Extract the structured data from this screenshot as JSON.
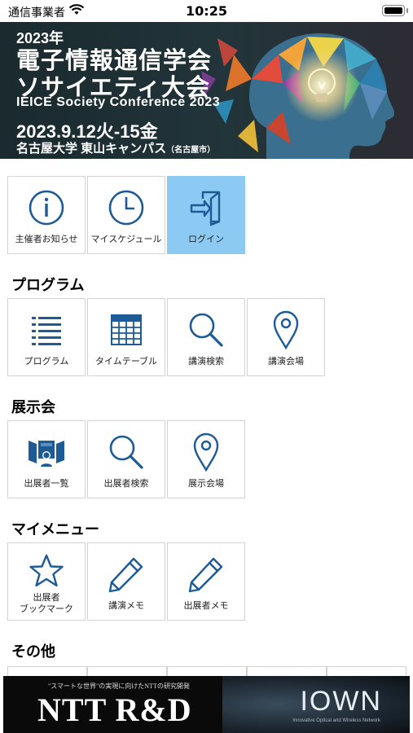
{
  "status_bar": {
    "carrier": "通信事業者",
    "time": "10:25"
  },
  "banner": {
    "year": "2023年",
    "title_line1": "電子情報通信学会",
    "title_line2": "ソサイエティ大会",
    "title_en": "IEICE Society Conference 2023",
    "date": "2023.9.12火-15金",
    "venue": "名古屋大学 東山キャンパス",
    "venue_city": "（名古屋市）"
  },
  "top_menu": [
    {
      "label": "主催者お知らせ",
      "icon": "info-icon"
    },
    {
      "label": "マイスケジュール",
      "icon": "clock-icon"
    },
    {
      "label": "ログイン",
      "icon": "login-icon",
      "active": true
    }
  ],
  "sections": {
    "program": {
      "title": "プログラム",
      "items": [
        {
          "label": "プログラム",
          "icon": "list-icon"
        },
        {
          "label": "タイムテーブル",
          "icon": "calendar-icon"
        },
        {
          "label": "講演検索",
          "icon": "search-icon"
        },
        {
          "label": "講演会場",
          "icon": "map-pin-icon"
        }
      ]
    },
    "exhibition": {
      "title": "展示会",
      "items": [
        {
          "label": "出展者一覧",
          "icon": "exhibitor-icon"
        },
        {
          "label": "出展者検索",
          "icon": "search-icon"
        },
        {
          "label": "展示会場",
          "icon": "map-pin-icon"
        }
      ]
    },
    "my_menu": {
      "title": "マイメニュー",
      "items": [
        {
          "label_line1": "出展者",
          "label_line2": "ブックマーク",
          "icon": "star-icon"
        },
        {
          "label": "講演メモ",
          "icon": "pencil-icon"
        },
        {
          "label": "出展者メモ",
          "icon": "pencil-icon"
        }
      ]
    },
    "other": {
      "title": "その他"
    }
  },
  "ad_banner": {
    "subtitle": "\"スマートな世界\"の実現に向けたNTTの研究開発",
    "title": "NTT R&D",
    "iown": "IOWN",
    "iown_sub": "Innovative Optical and Wireless Network"
  },
  "colors": {
    "accent_blue": "#1d5a96",
    "active_tile": "#8dcaf3",
    "tile_border": "#d3d3d3"
  }
}
